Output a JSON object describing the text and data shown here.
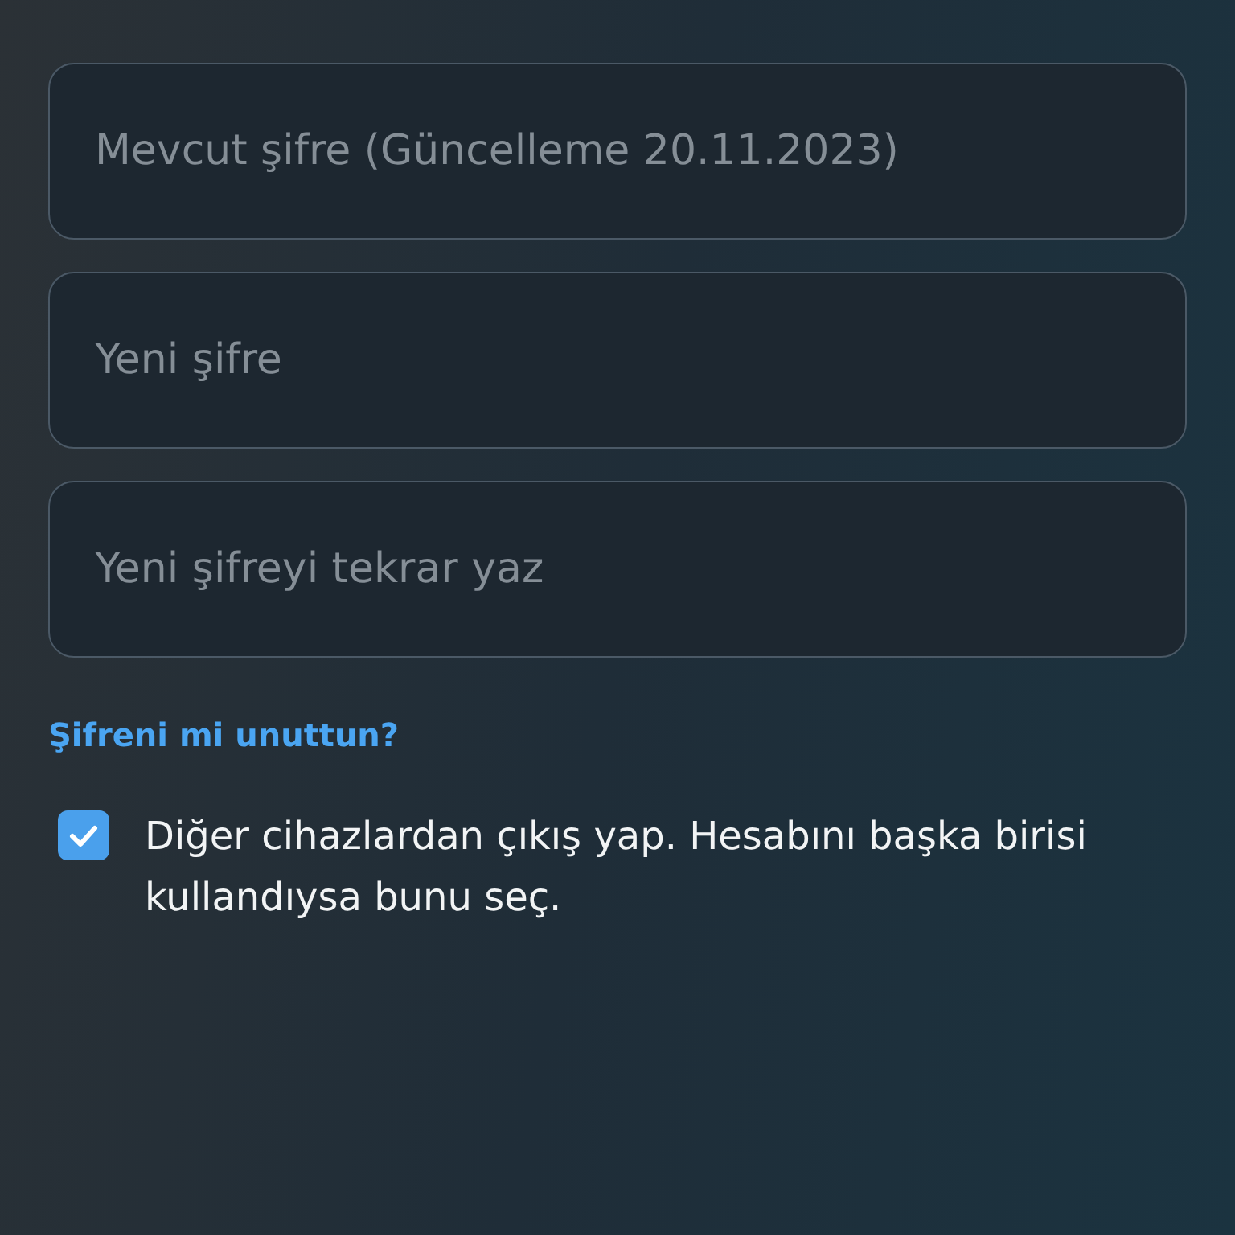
{
  "fields": [
    {
      "placeholder": "Mevcut şifre (Güncelleme 20.11.2023)"
    },
    {
      "placeholder": "Yeni şifre"
    },
    {
      "placeholder": "Yeni şifreyi tekrar yaz"
    }
  ],
  "forgot_link": "Şifreni mi unuttun?",
  "logout_option": {
    "label": "Diğer cihazlardan çıkış yap. Hesabını başka birisi kullandıysa bunu seç.",
    "checked": true
  }
}
